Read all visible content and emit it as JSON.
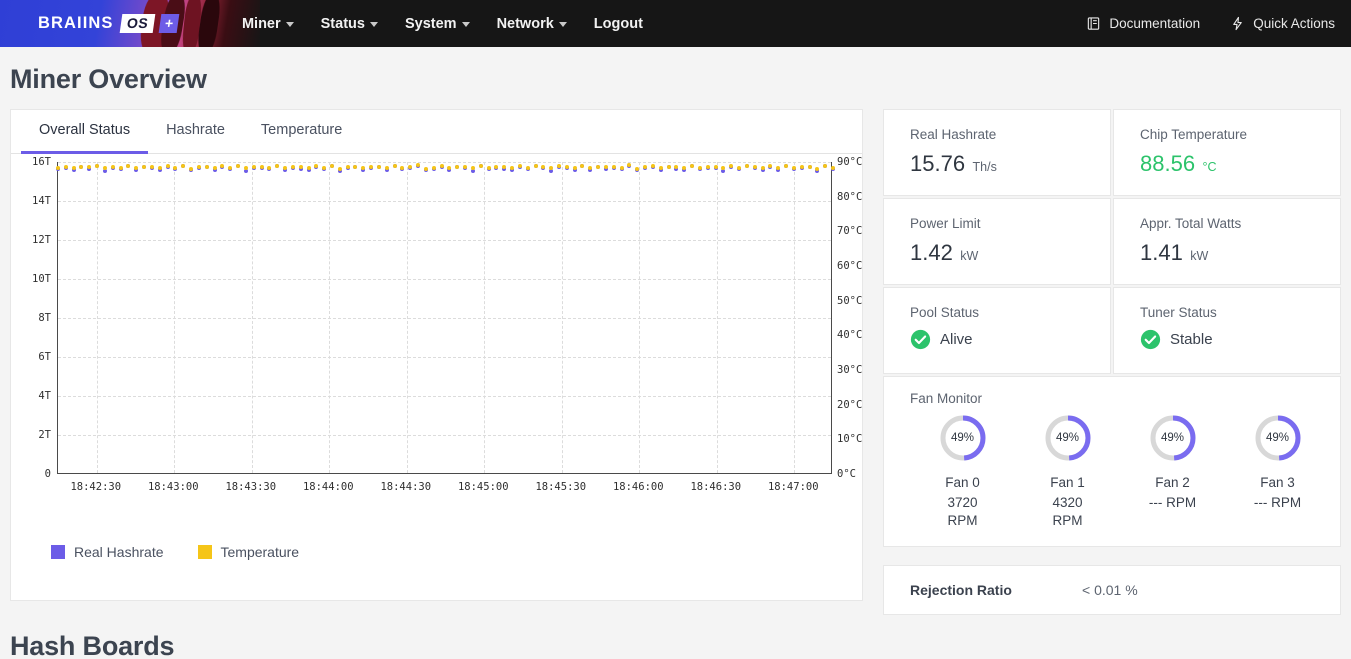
{
  "navbar": {
    "brand": {
      "name": "BRAIINS",
      "os": "OS",
      "plus": "+"
    },
    "links": [
      {
        "label": "Miner",
        "caret": true
      },
      {
        "label": "Status",
        "caret": true
      },
      {
        "label": "System",
        "caret": true
      },
      {
        "label": "Network",
        "caret": true
      },
      {
        "label": "Logout",
        "caret": false
      }
    ],
    "right": [
      {
        "label": "Documentation",
        "icon": "book-icon"
      },
      {
        "label": "Quick Actions",
        "icon": "lightning-icon"
      }
    ]
  },
  "page": {
    "title": "Miner Overview",
    "hash_boards_title": "Hash Boards"
  },
  "tabs": [
    {
      "label": "Overall Status",
      "active": true
    },
    {
      "label": "Hashrate",
      "active": false
    },
    {
      "label": "Temperature",
      "active": false
    }
  ],
  "chart_data": {
    "type": "scatter",
    "title": "",
    "xlabel": "",
    "ylabel": "",
    "grid": true,
    "legend_position": "bottom-left",
    "x_ticks": [
      "18:42:30",
      "18:43:00",
      "18:43:30",
      "18:44:00",
      "18:44:30",
      "18:45:00",
      "18:45:30",
      "18:46:00",
      "18:46:30",
      "18:47:00"
    ],
    "y_left_ticks": [
      "0",
      "2T",
      "4T",
      "6T",
      "8T",
      "10T",
      "12T",
      "14T",
      "16T"
    ],
    "y_left_values": [
      0,
      2,
      4,
      6,
      8,
      10,
      12,
      14,
      16
    ],
    "y_left_lim": [
      0,
      16
    ],
    "y_right_ticks": [
      "0°C",
      "10°C",
      "20°C",
      "30°C",
      "40°C",
      "50°C",
      "60°C",
      "70°C",
      "80°C",
      "90°C"
    ],
    "y_right_values": [
      0,
      10,
      20,
      30,
      40,
      50,
      60,
      70,
      80,
      90
    ],
    "y_right_lim": [
      0,
      90
    ],
    "series": [
      {
        "name": "Real Hashrate",
        "color": "#6c5ce7",
        "axis": "left",
        "unit": "Th/s",
        "values": [
          15.62,
          15.71,
          15.58,
          15.75,
          15.66,
          15.8,
          15.55,
          15.7,
          15.63,
          15.78,
          15.6,
          15.72,
          15.67,
          15.59,
          15.74,
          15.65,
          15.81,
          15.57,
          15.69,
          15.76,
          15.61,
          15.73,
          15.64,
          15.79,
          15.56,
          15.7,
          15.68,
          15.62,
          15.77,
          15.6,
          15.71,
          15.66,
          15.58,
          15.75,
          15.63,
          15.8,
          15.54,
          15.69,
          15.74,
          15.61,
          15.67,
          15.72,
          15.59,
          15.78,
          15.65,
          15.7,
          15.82,
          15.57,
          15.63,
          15.76,
          15.6,
          15.73,
          15.68,
          15.55,
          15.79,
          15.64,
          15.71,
          15.66,
          15.58,
          15.75,
          15.62,
          15.8,
          15.69,
          15.56,
          15.74,
          15.67,
          15.61,
          15.77,
          15.59,
          15.72,
          15.65,
          15.7,
          15.63,
          15.81,
          15.57,
          15.68,
          15.76,
          15.6,
          15.73,
          15.66,
          15.58,
          15.78,
          15.64,
          15.71,
          15.69,
          15.55,
          15.75,
          15.62,
          15.8,
          15.67,
          15.61,
          15.74,
          15.59,
          15.77,
          15.65,
          15.7,
          15.72,
          15.56,
          15.79,
          15.63
        ]
      },
      {
        "name": "Temperature",
        "color": "#f5c518",
        "axis": "right",
        "unit": "°C",
        "values": [
          88.4,
          88.6,
          88.3,
          88.7,
          88.5,
          88.8,
          88.2,
          88.6,
          88.4,
          88.9,
          88.3,
          88.7,
          88.5,
          88.2,
          88.8,
          88.4,
          88.9,
          88.1,
          88.6,
          88.7,
          88.3,
          88.8,
          88.4,
          88.9,
          88.2,
          88.6,
          88.5,
          88.3,
          88.8,
          88.4,
          88.7,
          88.5,
          88.2,
          88.9,
          88.4,
          88.8,
          88.1,
          88.6,
          88.7,
          88.3,
          88.5,
          88.7,
          88.2,
          88.9,
          88.4,
          88.6,
          89.0,
          88.1,
          88.4,
          88.8,
          88.3,
          88.7,
          88.5,
          88.2,
          88.9,
          88.4,
          88.7,
          88.5,
          88.2,
          88.8,
          88.4,
          88.9,
          88.6,
          88.2,
          88.8,
          88.5,
          88.3,
          88.9,
          88.2,
          88.7,
          88.5,
          88.6,
          88.4,
          89.0,
          88.1,
          88.5,
          88.8,
          88.3,
          88.7,
          88.5,
          88.2,
          88.9,
          88.4,
          88.7,
          88.6,
          88.2,
          88.8,
          88.4,
          88.9,
          88.5,
          88.3,
          88.8,
          88.2,
          88.9,
          88.4,
          88.6,
          88.7,
          88.1,
          88.9,
          88.4
        ]
      }
    ],
    "legend": [
      {
        "label": "Real Hashrate",
        "color": "#6c5ce7"
      },
      {
        "label": "Temperature",
        "color": "#f5c518"
      }
    ]
  },
  "stats": [
    {
      "label": "Real Hashrate",
      "value": "15.76",
      "unit": "Th/s",
      "green": false
    },
    {
      "label": "Chip Temperature",
      "value": "88.56",
      "unit": "°C",
      "green": true
    },
    {
      "label": "Power Limit",
      "value": "1.42",
      "unit": "kW",
      "green": false
    },
    {
      "label": "Appr. Total Watts",
      "value": "1.41",
      "unit": "kW",
      "green": false
    }
  ],
  "statuses": [
    {
      "label": "Pool Status",
      "value": "Alive",
      "icon": "check-circle-icon",
      "color": "#2cc36b"
    },
    {
      "label": "Tuner Status",
      "value": "Stable",
      "icon": "check-circle-icon",
      "color": "#2cc36b"
    }
  ],
  "fan_monitor": {
    "title": "Fan Monitor",
    "ring_color": "#7a6cf0",
    "track_color": "#d8d8d8",
    "fans": [
      {
        "name": "Fan 0",
        "percent": "49%",
        "percent_value": 49,
        "rpm": "3720 RPM"
      },
      {
        "name": "Fan 1",
        "percent": "49%",
        "percent_value": 49,
        "rpm": "4320 RPM"
      },
      {
        "name": "Fan 2",
        "percent": "49%",
        "percent_value": 49,
        "rpm": "--- RPM"
      },
      {
        "name": "Fan 3",
        "percent": "49%",
        "percent_value": 49,
        "rpm": "--- RPM"
      }
    ]
  },
  "rejection": {
    "label": "Rejection Ratio",
    "value": "< 0.01 %"
  }
}
